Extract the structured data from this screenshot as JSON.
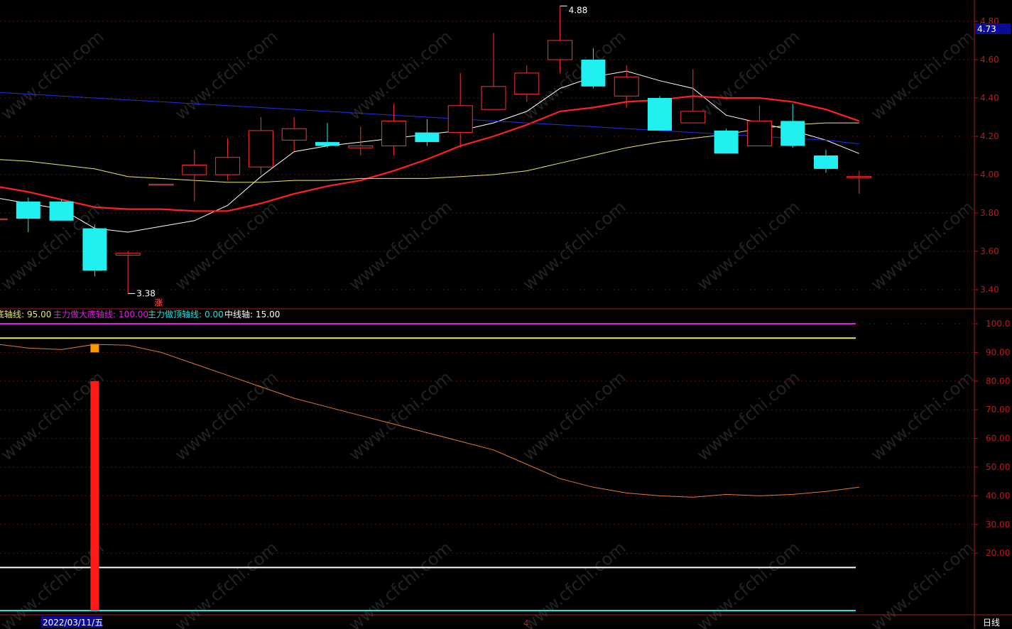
{
  "chart_data": [
    {
      "type": "candlestick",
      "price_axis": {
        "ticks": [
          "4.80",
          "4.60",
          "4.40",
          "4.20",
          "4.00",
          "3.80",
          "3.60",
          "3.40"
        ],
        "ylim": [
          3.36,
          4.92
        ],
        "current_label": "4.73",
        "current_value": 4.73
      },
      "annotations": {
        "high_label": "4.88",
        "high_value": 4.88,
        "low_label": "3.38",
        "low_value": 3.38,
        "marker_text": "涨"
      },
      "candles": [
        {
          "o": 3.77,
          "h": 3.78,
          "l": 3.76,
          "c": 3.77
        },
        {
          "o": 3.86,
          "h": 3.88,
          "l": 3.7,
          "c": 3.77
        },
        {
          "o": 3.86,
          "h": 3.87,
          "l": 3.77,
          "c": 3.76
        },
        {
          "o": 3.72,
          "h": 3.74,
          "l": 3.47,
          "c": 3.5
        },
        {
          "o": 3.58,
          "h": 3.6,
          "l": 3.38,
          "c": 3.59
        },
        {
          "o": 3.95,
          "h": 3.95,
          "l": 3.95,
          "c": 3.95
        },
        {
          "o": 4.0,
          "h": 4.13,
          "l": 3.86,
          "c": 4.05
        },
        {
          "o": 4.0,
          "h": 4.19,
          "l": 3.97,
          "c": 4.09
        },
        {
          "o": 4.04,
          "h": 4.3,
          "l": 4.0,
          "c": 4.23
        },
        {
          "o": 4.18,
          "h": 4.3,
          "l": 4.12,
          "c": 4.24
        },
        {
          "o": 4.17,
          "h": 4.27,
          "l": 4.14,
          "c": 4.15
        },
        {
          "o": 4.14,
          "h": 4.25,
          "l": 4.1,
          "c": 4.15
        },
        {
          "o": 4.15,
          "h": 4.37,
          "l": 4.1,
          "c": 4.28
        },
        {
          "o": 4.22,
          "h": 4.29,
          "l": 4.15,
          "c": 4.17
        },
        {
          "o": 4.22,
          "h": 4.53,
          "l": 4.14,
          "c": 4.36
        },
        {
          "o": 4.34,
          "h": 4.74,
          "l": 4.34,
          "c": 4.46
        },
        {
          "o": 4.42,
          "h": 4.57,
          "l": 4.38,
          "c": 4.53
        },
        {
          "o": 4.6,
          "h": 4.88,
          "l": 4.53,
          "c": 4.7
        },
        {
          "o": 4.6,
          "h": 4.66,
          "l": 4.45,
          "c": 4.46
        },
        {
          "o": 4.41,
          "h": 4.57,
          "l": 4.35,
          "c": 4.51
        },
        {
          "o": 4.4,
          "h": 4.41,
          "l": 4.23,
          "c": 4.23
        },
        {
          "o": 4.27,
          "h": 4.55,
          "l": 4.27,
          "c": 4.33
        },
        {
          "o": 4.23,
          "h": 4.24,
          "l": 4.11,
          "c": 4.11
        },
        {
          "o": 4.15,
          "h": 4.36,
          "l": 4.15,
          "c": 4.28
        },
        {
          "o": 4.28,
          "h": 4.37,
          "l": 4.14,
          "c": 4.15
        },
        {
          "o": 4.1,
          "h": 4.13,
          "l": 4.01,
          "c": 4.03
        },
        {
          "o": 3.99,
          "h": 4.02,
          "l": 3.9,
          "c": 3.99
        }
      ],
      "ma_lines": [
        {
          "color": "#ffffff",
          "values": [
            3.88,
            3.85,
            3.82,
            3.72,
            3.7,
            3.73,
            3.76,
            3.84,
            3.99,
            4.12,
            4.15,
            4.17,
            4.19,
            4.21,
            4.23,
            4.27,
            4.33,
            4.45,
            4.51,
            4.54,
            4.49,
            4.45,
            4.31,
            4.27,
            4.23,
            4.18,
            4.11
          ]
        },
        {
          "color": "#ff2020",
          "values": [
            3.94,
            3.91,
            3.87,
            3.83,
            3.82,
            3.82,
            3.81,
            3.81,
            3.85,
            3.9,
            3.94,
            3.97,
            4.02,
            4.08,
            4.15,
            4.2,
            4.26,
            4.33,
            4.35,
            4.38,
            4.39,
            4.41,
            4.4,
            4.4,
            4.38,
            4.34,
            4.28
          ]
        },
        {
          "color": "#e8e86a",
          "values": [
            4.08,
            4.07,
            4.05,
            4.03,
            3.99,
            3.98,
            3.97,
            3.96,
            3.96,
            3.97,
            3.97,
            3.98,
            3.98,
            3.98,
            3.99,
            4.0,
            4.02,
            4.06,
            4.1,
            4.14,
            4.17,
            4.19,
            4.21,
            4.24,
            4.26,
            4.27,
            4.27
          ]
        },
        {
          "color": "#2030e0",
          "values": [
            4.43,
            4.42,
            4.41,
            4.4,
            4.39,
            4.38,
            4.37,
            4.36,
            4.35,
            4.34,
            4.33,
            4.32,
            4.31,
            4.3,
            4.29,
            4.28,
            4.27,
            4.26,
            4.25,
            4.24,
            4.23,
            4.22,
            4.21,
            4.2,
            4.19,
            4.18,
            4.16
          ]
        }
      ]
    },
    {
      "type": "line",
      "legend": [
        {
          "label": "底轴线:",
          "value": "95.00",
          "color": "#e8e86a"
        },
        {
          "label": "主力做大底轴线:",
          "value": "100.00",
          "color": "#e020e0"
        },
        {
          "label": "主力做顶轴线:",
          "value": "0.00",
          "color": "#20e0e0"
        },
        {
          "label": "中线轴:",
          "value": "15.00",
          "color": "#ffffff"
        }
      ],
      "y_ticks": [
        "100.0",
        "90.00",
        "80.00",
        "70.00",
        "60.00",
        "50.00",
        "40.00",
        "30.00",
        "20.00"
      ],
      "ylim": [
        0,
        105
      ],
      "horizontal_lines": [
        {
          "value": 100,
          "color": "#e020e0"
        },
        {
          "value": 95,
          "color": "#e8e86a"
        },
        {
          "value": 15,
          "color": "#ffffff"
        },
        {
          "value": 0,
          "color": "#20e0e0"
        }
      ],
      "series_line": {
        "color": "#e07a30",
        "values": [
          93,
          91.5,
          91,
          92.8,
          92.5,
          90,
          86,
          82,
          78,
          74,
          71,
          68,
          65,
          62,
          59,
          56,
          51,
          46,
          43,
          41,
          40,
          39.5,
          40.5,
          40,
          40.5,
          41.5,
          43
        ]
      },
      "red_bar": {
        "index": 3,
        "from": 0,
        "to": 80,
        "color": "#ff1a1a"
      },
      "orange_marker": {
        "index": 3,
        "value": 90,
        "color": "#ff9900"
      }
    }
  ],
  "footer": {
    "date_label": "2022/03/11/五",
    "month_label": "4",
    "period_label": "日线"
  },
  "watermark": "www.cfchi.com"
}
